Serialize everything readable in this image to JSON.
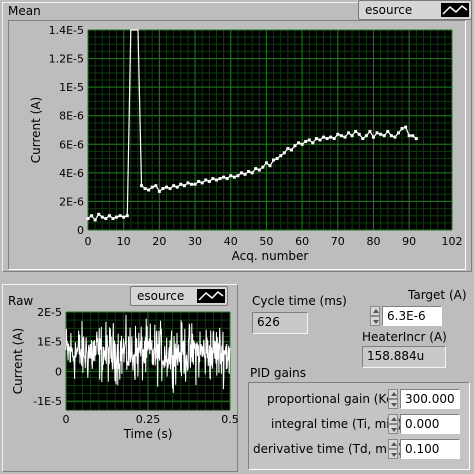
{
  "mean_panel": {
    "title": "Mean",
    "legend_label": "esource",
    "xlabel": "Acq. number",
    "ylabel": "Current (A)",
    "x_ticks": [
      "0",
      "10",
      "20",
      "30",
      "40",
      "50",
      "60",
      "70",
      "80",
      "90",
      "102"
    ],
    "y_ticks": [
      "0",
      "2E-6",
      "4E-6",
      "6E-6",
      "8E-6",
      "1E-5",
      "1.2E-5",
      "1.4E-5"
    ]
  },
  "raw_panel": {
    "title": "Raw",
    "legend_label": "esource",
    "xlabel": "Time (s)",
    "ylabel": "Current (A)",
    "x_ticks": [
      "0",
      "0.25",
      "0.5"
    ],
    "y_ticks": [
      "2E-5",
      "1E-5",
      "0",
      "-1E-5"
    ]
  },
  "cycle_time": {
    "label": "Cycle time (ms)",
    "value": "626"
  },
  "target": {
    "label": "Target (A)",
    "value": "6.3E-6"
  },
  "heater_incr": {
    "label": "HeaterIncr (A)",
    "value": "158.884u"
  },
  "pid": {
    "title": "PID gains",
    "kc": {
      "label": "proportional gain (Kc)",
      "value": "300.000"
    },
    "ti": {
      "label": "integral time (Ti, min)",
      "value": "0.000"
    },
    "td": {
      "label": "derivative time (Td, min)",
      "value": "0.100"
    }
  },
  "colors": {
    "plot_bg": "#000000",
    "grid": "#1f7a1f",
    "trace": "#ffffff",
    "window": "#bdbdbd"
  },
  "chart_data": [
    {
      "type": "line",
      "xlabel": "Acq. number",
      "ylabel": "Current (A)",
      "xlim": [
        0,
        102
      ],
      "ylim": [
        0,
        1.4e-05
      ],
      "grid": true,
      "series": [
        {
          "x": [
            0,
            1,
            2,
            3,
            4,
            5,
            6,
            7,
            8,
            9,
            10,
            11,
            12,
            13,
            14,
            15,
            16,
            17,
            18,
            19,
            20,
            21,
            22,
            23,
            24,
            25,
            26,
            27,
            28,
            29,
            30,
            31,
            32,
            33,
            34,
            35,
            36,
            37,
            38,
            39,
            40,
            41,
            42,
            43,
            44,
            45,
            46,
            47,
            48,
            49,
            50,
            51,
            52,
            53,
            54,
            55,
            56,
            57,
            58,
            59,
            60,
            61,
            62,
            63,
            64,
            65,
            66,
            67,
            68,
            69,
            70,
            71,
            72,
            73,
            74,
            75,
            76,
            77,
            78,
            79,
            80,
            81,
            82,
            83,
            84,
            85,
            86,
            87,
            88,
            89,
            90,
            91,
            92
          ],
          "y": [
            8e-07,
            1e-06,
            7e-07,
            1.1e-06,
            9e-07,
            8e-07,
            1e-06,
            8e-07,
            9e-07,
            1e-06,
            9e-07,
            1e-06,
            1.4e-05,
            1.4e-05,
            1.4e-05,
            3.1e-06,
            2.9e-06,
            2.8e-06,
            3e-06,
            3.1e-06,
            2.7e-06,
            2.9e-06,
            3e-06,
            2.9e-06,
            3.1e-06,
            3e-06,
            3.2e-06,
            3.1e-06,
            3.3e-06,
            3.2e-06,
            3.2e-06,
            3.4e-06,
            3.3e-06,
            3.5e-06,
            3.4e-06,
            3.6e-06,
            3.5e-06,
            3.6e-06,
            3.7e-06,
            3.6e-06,
            3.8e-06,
            3.7e-06,
            3.8e-06,
            4e-06,
            3.9e-06,
            4.1e-06,
            4e-06,
            4.3e-06,
            4.2e-06,
            4.4e-06,
            4.7e-06,
            4.5e-06,
            4.9e-06,
            5e-06,
            5.2e-06,
            5.4e-06,
            5.7e-06,
            5.6e-06,
            5.9e-06,
            6.1e-06,
            6e-06,
            6.2e-06,
            6.3e-06,
            6.1e-06,
            6.4e-06,
            6.3e-06,
            6.5e-06,
            6.4e-06,
            6.5e-06,
            6.4e-06,
            6.7e-06,
            6.6e-06,
            6.5e-06,
            6.8e-06,
            6.6e-06,
            6.9e-06,
            6.7e-06,
            6.4e-06,
            6.6e-06,
            6.9e-06,
            6.5e-06,
            6.8e-06,
            6.7e-06,
            6.6e-06,
            6.9e-06,
            6.6e-06,
            6.5e-06,
            6.8e-06,
            7.1e-06,
            7.2e-06,
            6.6e-06,
            6.6e-06,
            6.4e-06
          ]
        }
      ]
    },
    {
      "type": "line",
      "xlabel": "Time (s)",
      "ylabel": "Current (A)",
      "xlim": [
        0,
        0.5
      ],
      "ylim": [
        -1.3e-05,
        2e-05
      ],
      "grid": true,
      "series": [
        {
          "noise_mean": 6.3e-06,
          "noise_amplitude": 1.1e-05,
          "samples": 400
        }
      ]
    }
  ]
}
